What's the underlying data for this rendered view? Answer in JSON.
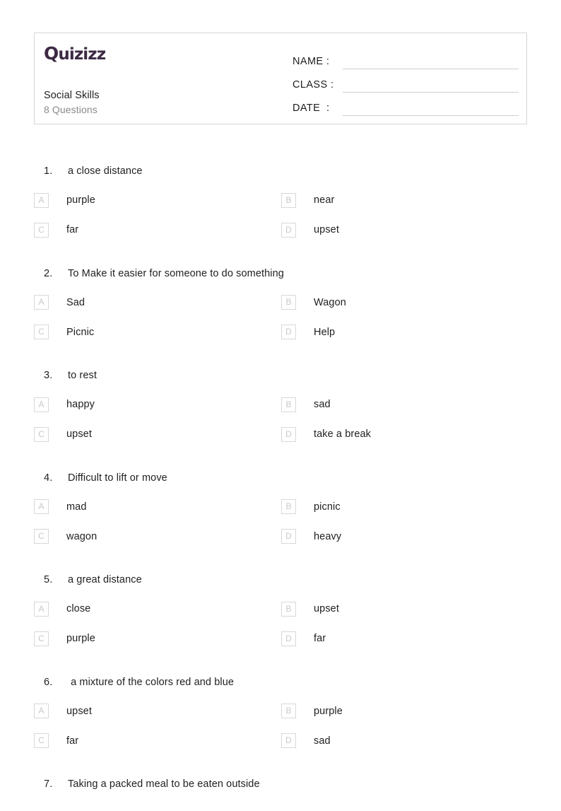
{
  "header": {
    "brand": {
      "cap": "Q",
      "rest": "uizizz"
    },
    "title": "Social Skills",
    "question_count": "8 Questions",
    "fields": [
      {
        "label": "NAME :",
        "value": ""
      },
      {
        "label": "CLASS :",
        "value": ""
      },
      {
        "label": "DATE  :",
        "value": ""
      }
    ]
  },
  "questions": [
    {
      "number": "1.",
      "text": "a close distance",
      "options": [
        {
          "key": "A",
          "text": "purple"
        },
        {
          "key": "B",
          "text": "near"
        },
        {
          "key": "C",
          "text": "far"
        },
        {
          "key": "D",
          "text": "upset"
        }
      ]
    },
    {
      "number": "2.",
      "text": "To Make it easier for someone to do something",
      "options": [
        {
          "key": "A",
          "text": "Sad"
        },
        {
          "key": "B",
          "text": "Wagon"
        },
        {
          "key": "C",
          "text": "Picnic"
        },
        {
          "key": "D",
          "text": "Help"
        }
      ]
    },
    {
      "number": "3.",
      "text": "to rest",
      "options": [
        {
          "key": "A",
          "text": "happy"
        },
        {
          "key": "B",
          "text": "sad"
        },
        {
          "key": "C",
          "text": "upset"
        },
        {
          "key": "D",
          "text": "take a break"
        }
      ]
    },
    {
      "number": "4.",
      "text": "Difficult to lift or move",
      "options": [
        {
          "key": "A",
          "text": "mad"
        },
        {
          "key": "B",
          "text": "picnic"
        },
        {
          "key": "C",
          "text": "wagon"
        },
        {
          "key": "D",
          "text": "heavy"
        }
      ]
    },
    {
      "number": "5.",
      "text": "a great distance",
      "options": [
        {
          "key": "A",
          "text": "close"
        },
        {
          "key": "B",
          "text": "upset"
        },
        {
          "key": "C",
          "text": "purple"
        },
        {
          "key": "D",
          "text": "far"
        }
      ]
    },
    {
      "number": "6.",
      "text": " a mixture of the colors red and blue",
      "options": [
        {
          "key": "A",
          "text": "upset"
        },
        {
          "key": "B",
          "text": "purple"
        },
        {
          "key": "C",
          "text": "far"
        },
        {
          "key": "D",
          "text": "sad"
        }
      ]
    },
    {
      "number": "7.",
      "text": "Taking a packed meal to be eaten outside",
      "options": []
    }
  ],
  "colors": {
    "brand": "#3d2a44",
    "text": "#1f1f1f",
    "muted": "#8a8a8a",
    "border": "#d6d6d6",
    "option_key": "#c9c9c9"
  }
}
